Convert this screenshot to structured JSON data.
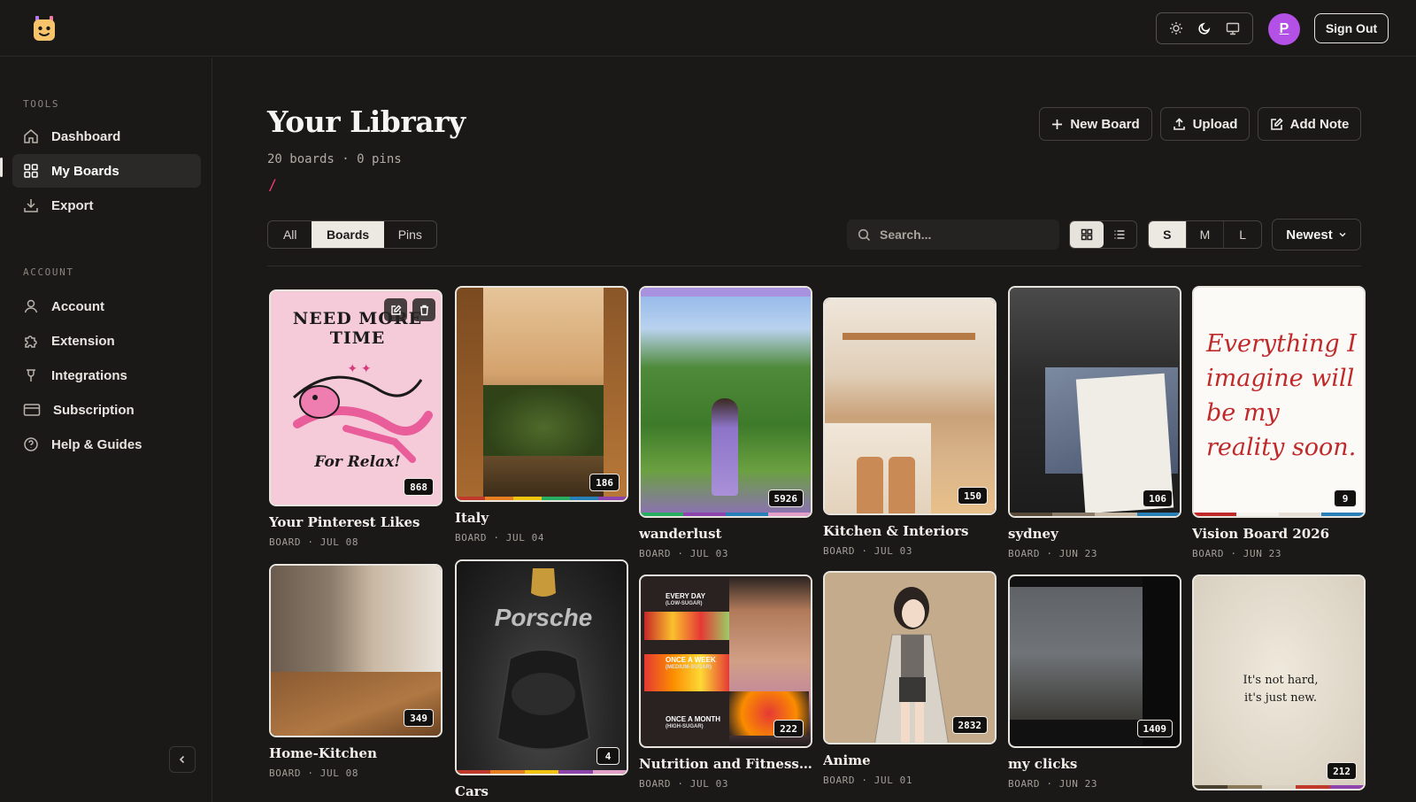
{
  "header": {
    "avatar_initial": "P",
    "signout_label": "Sign Out",
    "theme_options": [
      "sun-icon",
      "moon-icon",
      "monitor-icon"
    ],
    "active_theme": "moon-icon"
  },
  "sidebar": {
    "tools_heading": "TOOLS",
    "tools": [
      {
        "label": "Dashboard",
        "icon": "home-icon"
      },
      {
        "label": "My Boards",
        "icon": "grid-icon",
        "active": true
      },
      {
        "label": "Export",
        "icon": "download-icon"
      }
    ],
    "account_heading": "ACCOUNT",
    "account": [
      {
        "label": "Account",
        "icon": "user-icon"
      },
      {
        "label": "Extension",
        "icon": "puzzle-icon"
      },
      {
        "label": "Integrations",
        "icon": "plug-icon"
      },
      {
        "label": "Subscription",
        "icon": "card-icon"
      },
      {
        "label": "Help & Guides",
        "icon": "help-icon"
      }
    ]
  },
  "main": {
    "title": "Your Library",
    "subtitle": "20 boards · 0 pins",
    "slash": "/",
    "actions": {
      "new_board": "New Board",
      "upload": "Upload",
      "add_note": "Add Note"
    },
    "filters": [
      "All",
      "Boards",
      "Pins"
    ],
    "active_filter": "Boards",
    "search_placeholder": "Search...",
    "sizes": [
      "S",
      "M",
      "L"
    ],
    "active_size": "S",
    "sort_label": "Newest"
  },
  "boards": [
    {
      "title": "Your Pinterest Likes",
      "meta": "BOARD · JUL 08",
      "count": "868",
      "overlay_top": "NEED MORE TIME",
      "overlay_bottom": "For Relax!"
    },
    {
      "title": "Italy",
      "meta": "BOARD · JUL 04",
      "count": "186"
    },
    {
      "title": "wanderlust",
      "meta": "BOARD · JUL 03",
      "count": "5926"
    },
    {
      "title": "Kitchen & Interiors",
      "meta": "BOARD · JUL 03",
      "count": "150"
    },
    {
      "title": "sydney",
      "meta": "BOARD · JUN 23",
      "count": "106"
    },
    {
      "title": "Vision Board 2026",
      "meta": "BOARD · JUN 23",
      "count": "9",
      "overlay_text": "Everything I imagine will be my reality soon."
    },
    {
      "title": "Home-Kitchen",
      "meta": "BOARD · JUL 08",
      "count": "349"
    },
    {
      "title": "Cars",
      "meta": "",
      "count": "4",
      "overlay_text": "Porsche"
    },
    {
      "title": "Nutrition and Fitness ide...",
      "meta": "BOARD · JUL 03",
      "count": "222",
      "overlay_lines": [
        "EVERY DAY",
        "(LOW-SUGAR)",
        "ONCE A WEEK",
        "(MEDIUM-SUGAR)",
        "ONCE A MONTH",
        "(HIGH-SUGAR)"
      ]
    },
    {
      "title": "Anime",
      "meta": "BOARD · JUL 01",
      "count": "2832"
    },
    {
      "title": "my clicks",
      "meta": "BOARD · JUN 23",
      "count": "1409"
    },
    {
      "title": "",
      "meta": "",
      "count": "212",
      "overlay_lines": [
        "It's not hard,",
        "it's just new."
      ]
    }
  ]
}
